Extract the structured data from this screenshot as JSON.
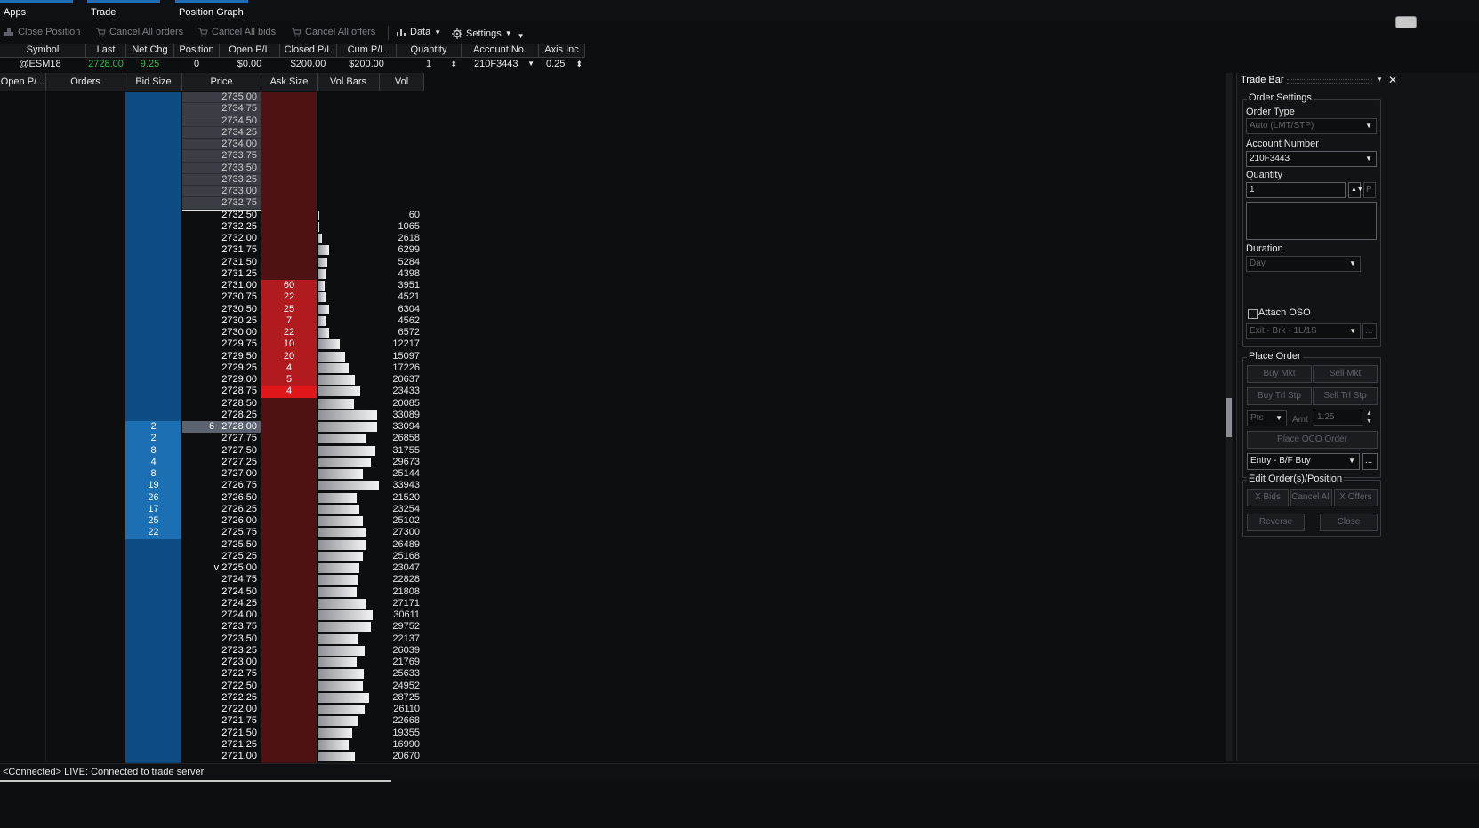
{
  "tabs": [
    "Apps",
    "Trade",
    "Position Graph"
  ],
  "toolbar": {
    "close_position": "Close Position",
    "cancel_all_orders": "Cancel All orders",
    "cancel_all_bids": "Cancel All bids",
    "cancel_all_offers": "Cancel All offers",
    "data": "Data",
    "settings": "Settings"
  },
  "summary": {
    "headers": [
      "Symbol",
      "Last",
      "Net Chg",
      "Position",
      "Open P/L",
      "Closed P/L",
      "Cum P/L",
      "Quantity",
      "Account No.",
      "Axis Inc"
    ],
    "values": {
      "symbol": "@ESM18",
      "last": "2728.00",
      "net_chg": "9.25",
      "position": "0",
      "open_pl": "$0.00",
      "closed_pl": "$200.00",
      "cum_pl": "$200.00",
      "quantity": "1",
      "account": "210F3443",
      "axis_inc": "0.25"
    },
    "positive_color": "#2fb84a"
  },
  "ladder": {
    "headers": [
      "Open P/...",
      "Orders",
      "Bid Size",
      "Price",
      "Ask Size",
      "Vol Bars",
      "Vol"
    ],
    "rows": [
      {
        "price": "2735.00",
        "bid": "",
        "ask": "",
        "vol": "",
        "zone": "up"
      },
      {
        "price": "2734.75",
        "bid": "",
        "ask": "",
        "vol": "",
        "zone": "up"
      },
      {
        "price": "2734.50",
        "bid": "",
        "ask": "",
        "vol": "",
        "zone": "up"
      },
      {
        "price": "2734.25",
        "bid": "",
        "ask": "",
        "vol": "",
        "zone": "up"
      },
      {
        "price": "2734.00",
        "bid": "",
        "ask": "",
        "vol": "",
        "zone": "up"
      },
      {
        "price": "2733.75",
        "bid": "",
        "ask": "",
        "vol": "",
        "zone": "up"
      },
      {
        "price": "2733.50",
        "bid": "",
        "ask": "",
        "vol": "",
        "zone": "up"
      },
      {
        "price": "2733.25",
        "bid": "",
        "ask": "",
        "vol": "",
        "zone": "up"
      },
      {
        "price": "2733.00",
        "bid": "",
        "ask": "",
        "vol": "",
        "zone": "up"
      },
      {
        "price": "2732.75",
        "bid": "",
        "ask": "",
        "vol": "",
        "zone": "up"
      },
      {
        "price": "2732.50",
        "bid": "",
        "ask": "",
        "vol": "60",
        "zone": ""
      },
      {
        "price": "2732.25",
        "bid": "",
        "ask": "",
        "vol": "1065",
        "zone": ""
      },
      {
        "price": "2732.00",
        "bid": "",
        "ask": "",
        "vol": "2618",
        "zone": ""
      },
      {
        "price": "2731.75",
        "bid": "",
        "ask": "",
        "vol": "6299",
        "zone": ""
      },
      {
        "price": "2731.50",
        "bid": "",
        "ask": "",
        "vol": "5284",
        "zone": ""
      },
      {
        "price": "2731.25",
        "bid": "",
        "ask": "",
        "vol": "4398",
        "zone": ""
      },
      {
        "price": "2731.00",
        "bid": "",
        "ask": "60",
        "vol": "3951",
        "zone": ""
      },
      {
        "price": "2730.75",
        "bid": "",
        "ask": "22",
        "vol": "4521",
        "zone": ""
      },
      {
        "price": "2730.50",
        "bid": "",
        "ask": "25",
        "vol": "6304",
        "zone": ""
      },
      {
        "price": "2730.25",
        "bid": "",
        "ask": "7",
        "vol": "4562",
        "zone": ""
      },
      {
        "price": "2730.00",
        "bid": "",
        "ask": "22",
        "vol": "6572",
        "zone": ""
      },
      {
        "price": "2729.75",
        "bid": "",
        "ask": "10",
        "vol": "12217",
        "zone": ""
      },
      {
        "price": "2729.50",
        "bid": "",
        "ask": "20",
        "vol": "15097",
        "zone": ""
      },
      {
        "price": "2729.25",
        "bid": "",
        "ask": "4",
        "vol": "17226",
        "zone": ""
      },
      {
        "price": "2729.00",
        "bid": "",
        "ask": "5",
        "vol": "20637",
        "zone": ""
      },
      {
        "price": "2728.75",
        "bid": "",
        "ask": "4",
        "vol": "23433",
        "zone": "bestask"
      },
      {
        "price": "2728.50",
        "bid": "",
        "ask": "",
        "vol": "20085",
        "zone": ""
      },
      {
        "price": "2728.25",
        "bid": "",
        "ask": "",
        "vol": "33089",
        "zone": ""
      },
      {
        "price": "2728.00",
        "bid": "2",
        "ask": "",
        "vol": "33094",
        "zone": "cur",
        "orders_at_price": "6"
      },
      {
        "price": "2727.75",
        "bid": "2",
        "ask": "",
        "vol": "26858",
        "zone": ""
      },
      {
        "price": "2727.50",
        "bid": "8",
        "ask": "",
        "vol": "31755",
        "zone": ""
      },
      {
        "price": "2727.25",
        "bid": "4",
        "ask": "",
        "vol": "29673",
        "zone": ""
      },
      {
        "price": "2727.00",
        "bid": "8",
        "ask": "",
        "vol": "25144",
        "zone": ""
      },
      {
        "price": "2726.75",
        "bid": "19",
        "ask": "",
        "vol": "33943",
        "zone": ""
      },
      {
        "price": "2726.50",
        "bid": "26",
        "ask": "",
        "vol": "21520",
        "zone": ""
      },
      {
        "price": "2726.25",
        "bid": "17",
        "ask": "",
        "vol": "23254",
        "zone": ""
      },
      {
        "price": "2726.00",
        "bid": "25",
        "ask": "",
        "vol": "25102",
        "zone": ""
      },
      {
        "price": "2725.75",
        "bid": "22",
        "ask": "",
        "vol": "27300",
        "zone": ""
      },
      {
        "price": "2725.50",
        "bid": "",
        "ask": "",
        "vol": "26489",
        "zone": ""
      },
      {
        "price": "2725.25",
        "bid": "",
        "ask": "",
        "vol": "25168",
        "zone": ""
      },
      {
        "price": "v 2725.00",
        "bid": "",
        "ask": "",
        "vol": "23047",
        "zone": ""
      },
      {
        "price": "2724.75",
        "bid": "",
        "ask": "",
        "vol": "22828",
        "zone": ""
      },
      {
        "price": "2724.50",
        "bid": "",
        "ask": "",
        "vol": "21808",
        "zone": ""
      },
      {
        "price": "2724.25",
        "bid": "",
        "ask": "",
        "vol": "27171",
        "zone": ""
      },
      {
        "price": "2724.00",
        "bid": "",
        "ask": "",
        "vol": "30611",
        "zone": ""
      },
      {
        "price": "2723.75",
        "bid": "",
        "ask": "",
        "vol": "29752",
        "zone": ""
      },
      {
        "price": "2723.50",
        "bid": "",
        "ask": "",
        "vol": "22137",
        "zone": ""
      },
      {
        "price": "2723.25",
        "bid": "",
        "ask": "",
        "vol": "26039",
        "zone": ""
      },
      {
        "price": "2723.00",
        "bid": "",
        "ask": "",
        "vol": "21769",
        "zone": ""
      },
      {
        "price": "2722.75",
        "bid": "",
        "ask": "",
        "vol": "25633",
        "zone": ""
      },
      {
        "price": "2722.50",
        "bid": "",
        "ask": "",
        "vol": "24952",
        "zone": ""
      },
      {
        "price": "2722.25",
        "bid": "",
        "ask": "",
        "vol": "28725",
        "zone": ""
      },
      {
        "price": "2722.00",
        "bid": "",
        "ask": "",
        "vol": "26110",
        "zone": ""
      },
      {
        "price": "2721.75",
        "bid": "",
        "ask": "",
        "vol": "22668",
        "zone": ""
      },
      {
        "price": "2721.50",
        "bid": "",
        "ask": "",
        "vol": "19355",
        "zone": ""
      },
      {
        "price": "2721.25",
        "bid": "",
        "ask": "",
        "vol": "16990",
        "zone": ""
      },
      {
        "price": "2721.00",
        "bid": "",
        "ask": "",
        "vol": "20670",
        "zone": ""
      }
    ],
    "max_vol": 33943,
    "last_trade_marker_price": "2732.50"
  },
  "trade_bar": {
    "title": "Trade Bar",
    "order_settings": "Order Settings",
    "order_type_label": "Order Type",
    "order_type_value": "Auto (LMT/STP)",
    "account_label": "Account Number",
    "account_value": "210F3443",
    "quantity_label": "Quantity",
    "quantity_value": "1",
    "quantity_p": "P",
    "duration_label": "Duration",
    "duration_value": "Day",
    "attach_oso": "Attach OSO",
    "oso_value": "Exit - Brk - 1L/1S",
    "more": "...",
    "place_order": "Place Order",
    "buy_mkt": "Buy Mkt",
    "sell_mkt": "Sell Mkt",
    "buy_trl_stp": "Buy Trl Stp",
    "sell_trl_stp": "Sell Trl Stp",
    "pts": "Pts",
    "amt": "Amt",
    "amt_value": "1.25",
    "place_oco": "Place OCO Order",
    "entry_value": "Entry - B/F Buy",
    "edit_orders": "Edit Order(s)/Position",
    "x_bids": "X Bids",
    "cancel_all": "Cancel All",
    "x_offers": "X Offers",
    "reverse": "Reverse",
    "close": "Close"
  },
  "status": {
    "text": "<Connected> LIVE:  Connected to trade server"
  },
  "colors": {
    "bid": "#0d4d84",
    "bid_active": "#1d6fb4",
    "ask": "#4f1214",
    "ask_active": "#b21b1e",
    "ask_best": "#e0161a",
    "accent": "#1e6fb8"
  }
}
